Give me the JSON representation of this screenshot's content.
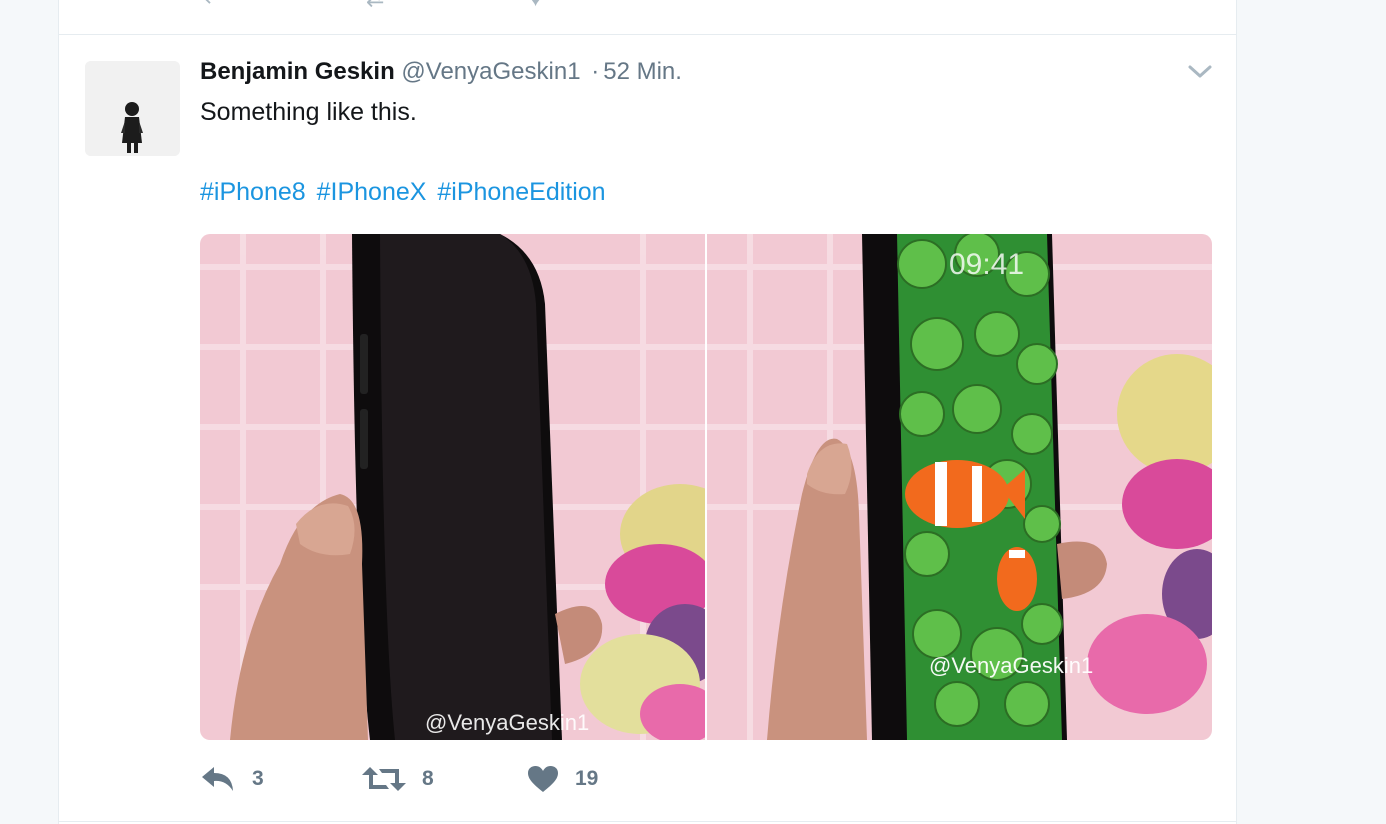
{
  "colors": {
    "link": "#1b95e0",
    "text_primary": "#14171a",
    "text_secondary": "#657786",
    "icon": "#657786"
  },
  "tweet": {
    "author": {
      "fullname": "Benjamin Geskin",
      "username": "@VenyaGeskin1"
    },
    "separator": "·",
    "timestamp": "52 Min.",
    "text": "Something like this.",
    "hashtags": [
      "#iPhone8",
      "#IPhoneX",
      "#iPhoneEdition"
    ],
    "media": [
      {
        "watermark": "@VenyaGeskin1"
      },
      {
        "watermark": "@VenyaGeskin1",
        "lockscreen_time": "09:41"
      }
    ],
    "actions": {
      "reply": {
        "icon": "reply-icon",
        "count": "3"
      },
      "retweet": {
        "icon": "retweet-icon",
        "count": "8"
      },
      "like": {
        "icon": "heart-icon",
        "count": "19"
      }
    },
    "menu_icon": "chevron-down-icon"
  }
}
